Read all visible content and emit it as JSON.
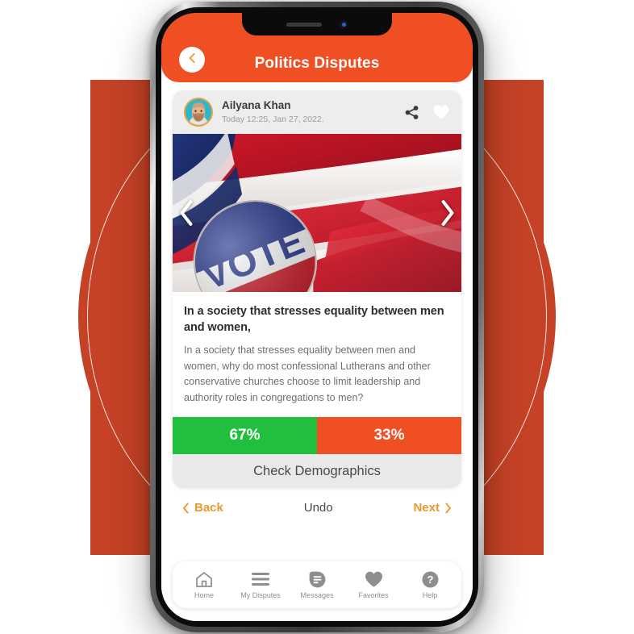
{
  "header": {
    "title": "Politics Disputes",
    "back_icon": "chevron-left-icon"
  },
  "post": {
    "author": "Ailyana Khan",
    "timestamp": "Today  12:25, Jan 27, 2022.",
    "share_icon": "share-icon",
    "favorite_icon": "heart-icon",
    "image_alt": "VOTE badge on American flag",
    "carousel_prev_icon": "chevron-left-icon",
    "carousel_next_icon": "chevron-right-icon",
    "title": "In a society that stresses equality between men and women,",
    "body": "In a society that stresses equality between men and women, why do most confessional Lutherans and other conservative churches choose to limit leadership and authority roles in congregations to men?",
    "demographics_label": "Check Demographics"
  },
  "poll": {
    "agree_label": "67%",
    "disagree_label": "33%",
    "agree_color": "#20BF3E",
    "disagree_color": "#F04E23"
  },
  "nav": {
    "back_label": "Back",
    "undo_label": "Undo",
    "next_label": "Next",
    "back_icon": "chevron-left-icon",
    "next_icon": "chevron-right-icon",
    "link_color": "#E79B2E"
  },
  "tabbar": {
    "items": [
      {
        "label": "Home",
        "icon": "home-icon"
      },
      {
        "label": "My Disputes",
        "icon": "list-lines-icon"
      },
      {
        "label": "Messages",
        "icon": "message-doc-icon"
      },
      {
        "label": "Favorites",
        "icon": "heart-filled-icon"
      },
      {
        "label": "Help",
        "icon": "question-circle-icon"
      }
    ]
  },
  "theme": {
    "brand_orange": "#F04E23",
    "decor_terracotta": "#C64226",
    "gold": "#E8A33D"
  }
}
